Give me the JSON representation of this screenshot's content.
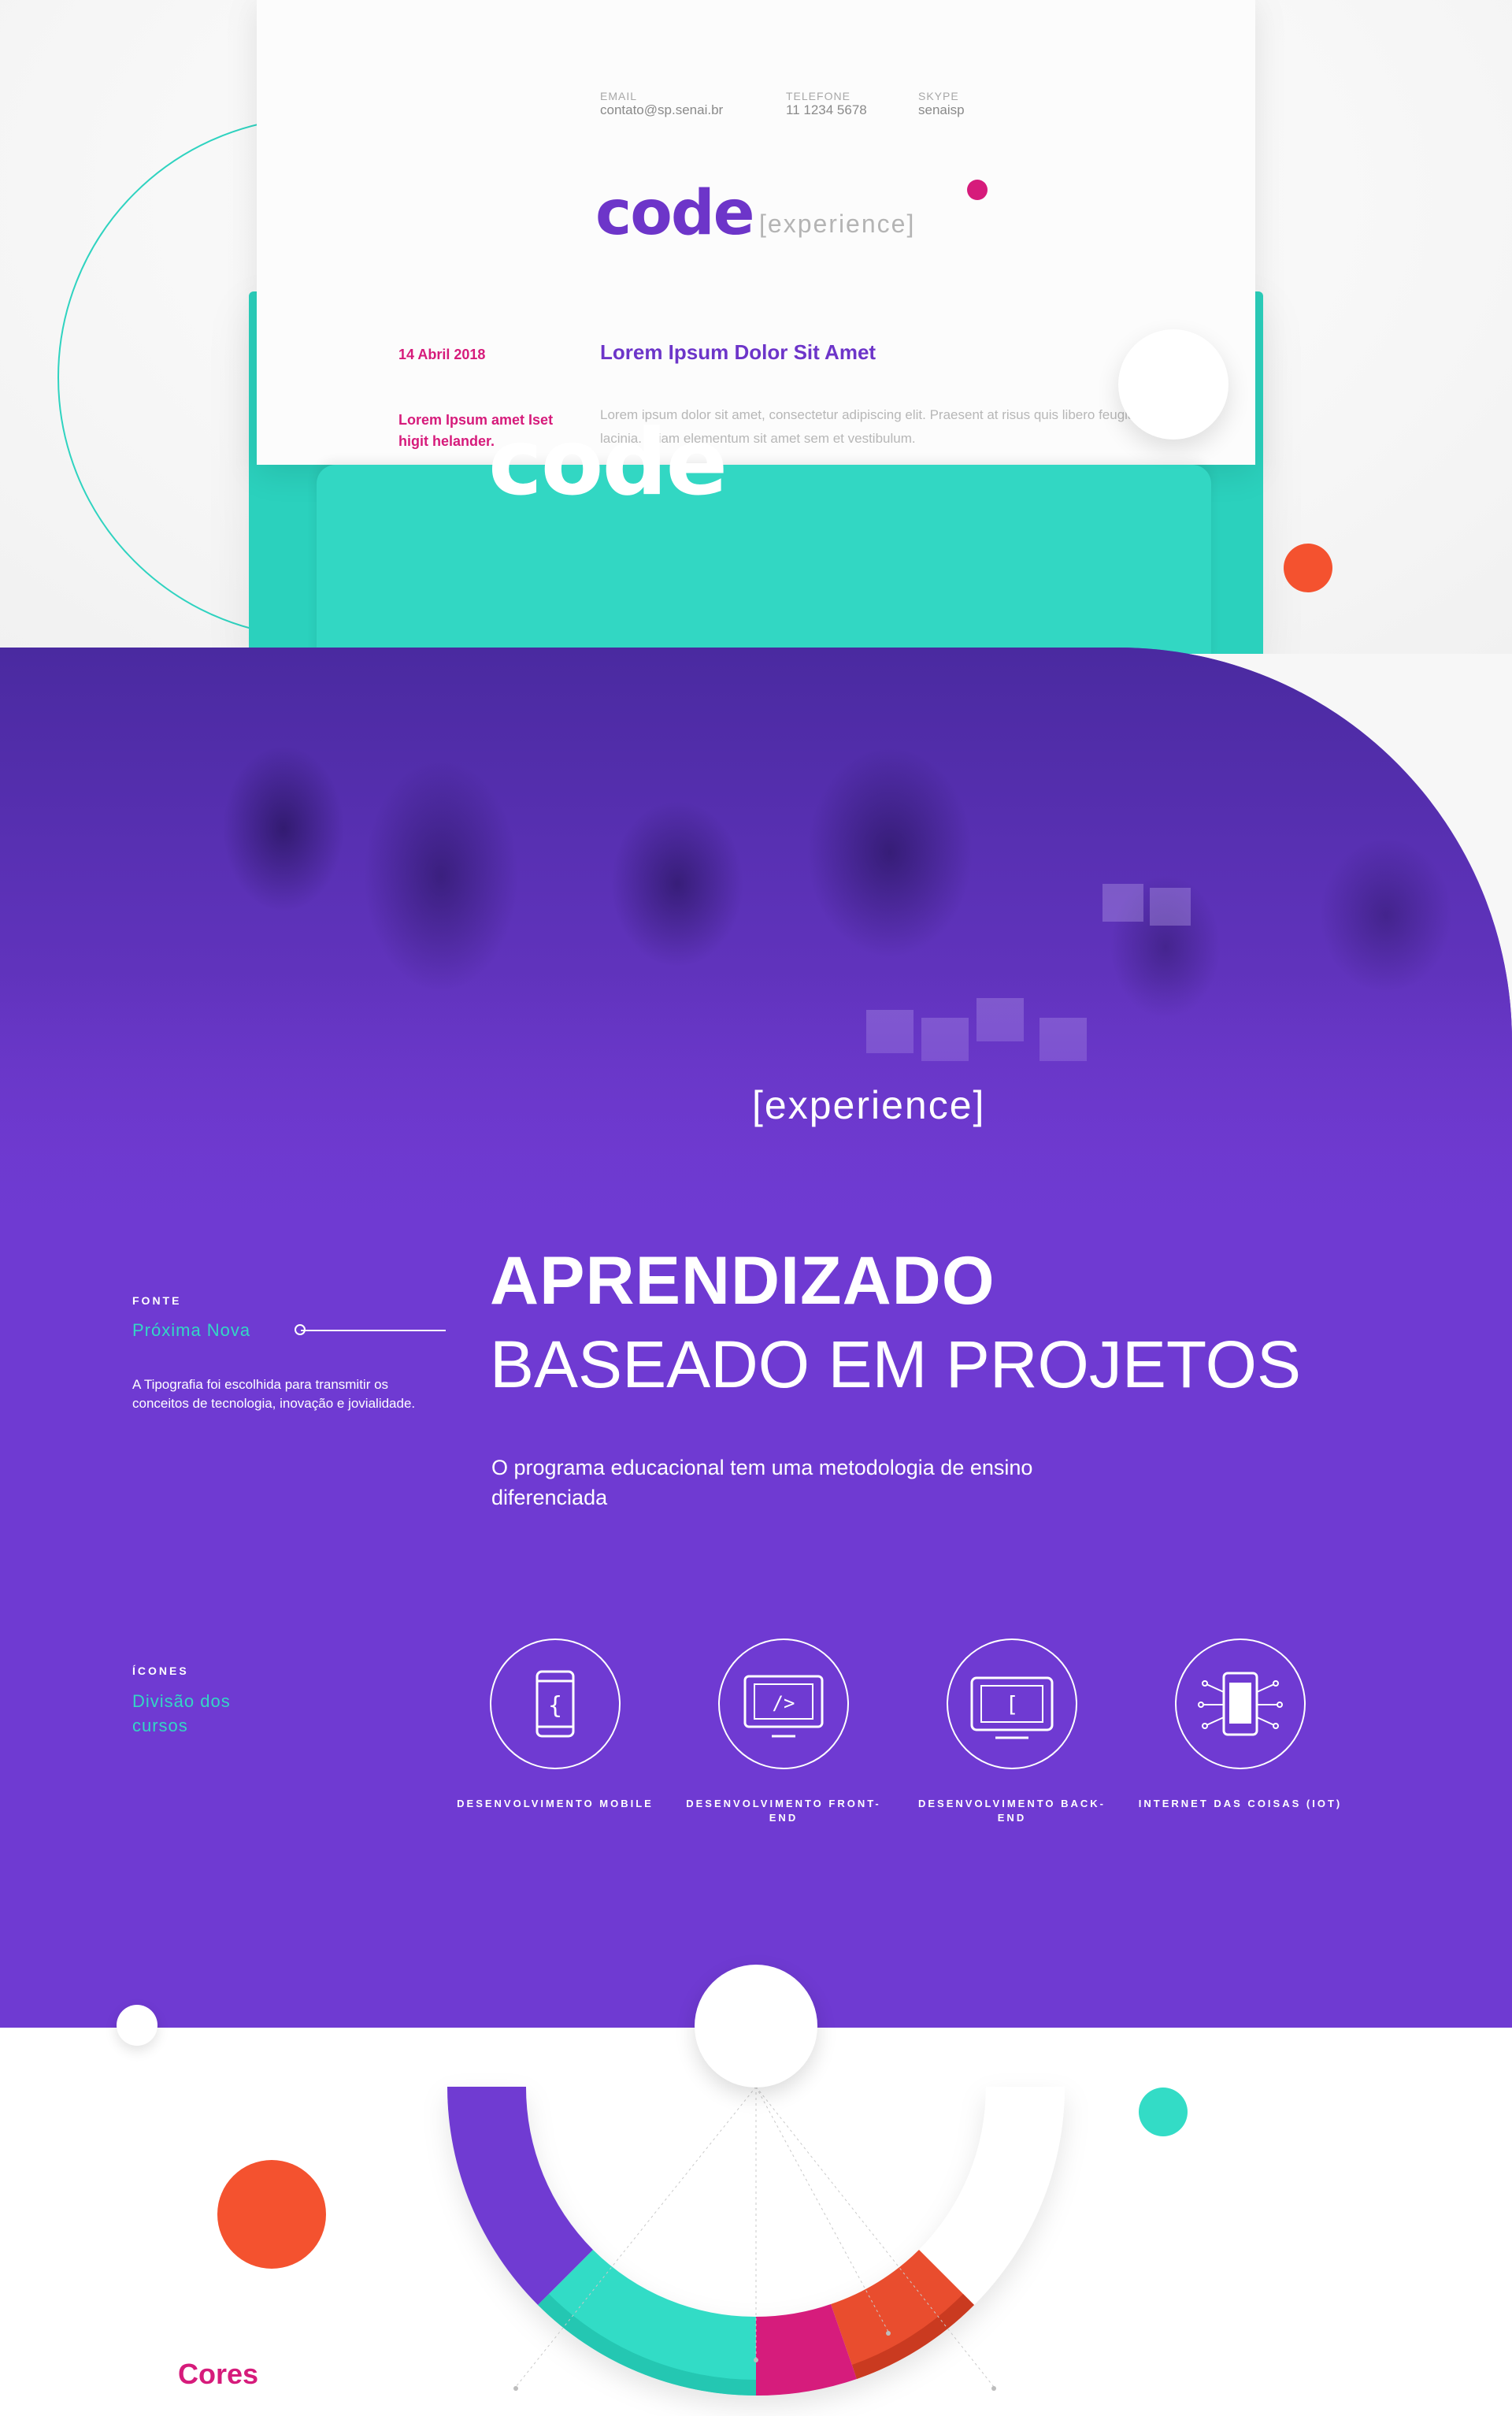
{
  "letter": {
    "contacts": [
      {
        "label": "EMAIL",
        "value": "contato@sp.senai.br"
      },
      {
        "label": "TELEFONE",
        "value": "11 1234 5678"
      },
      {
        "label": "SKYPE",
        "value": "senaisp"
      }
    ],
    "logo_code": "code",
    "logo_experience": "[experience]",
    "date": "14 Abril 2018",
    "heading": "Lorem Ipsum Dolor Sit Amet",
    "side_text": "Lorem Ipsum amet Iset higit helander.",
    "body": "Lorem ipsum dolor sit amet, consectetur adipiscing elit. Praesent at risus quis libero feugiat lacinia. Etiam elementum sit amet sem et vestibulum."
  },
  "hero": {
    "logo_code": "code",
    "logo_experience": "[experience]",
    "heading_line1": "APRENDIZADO",
    "heading_line2": "BASEADO EM PROJETOS",
    "subtitle": "O programa educacional tem uma metodologia de ensino diferenciada"
  },
  "font_info": {
    "label": "FONTE",
    "name": "Próxima Nova",
    "description": "A Tipografia foi escolhida para transmitir os conceitos de tecnologia, inovação e jovialidade."
  },
  "icons_info": {
    "label": "ÍCONES",
    "name": "Divisão dos cursos"
  },
  "courses": [
    {
      "caption": "DESENVOLVIMENTO MOBILE",
      "icon": "mobile-braces-icon"
    },
    {
      "caption": "DESENVOLVIMENTO FRONT-END",
      "icon": "monitor-code-icon"
    },
    {
      "caption": "DESENVOLVIMENTO BACK-END",
      "icon": "tablet-bracket-icon"
    },
    {
      "caption": "INTERNET DAS COISAS (IOT)",
      "icon": "chip-circuit-icon"
    }
  ],
  "colors_section": {
    "label": "Cores",
    "palette": [
      "#6f3ad2",
      "#33dcc6",
      "#d61b7b",
      "#e94e2f"
    ]
  },
  "palette": {
    "purple": "#6f3ad2",
    "teal": "#2bd1bd",
    "magenta": "#d61b7b",
    "orange": "#f4522f"
  }
}
